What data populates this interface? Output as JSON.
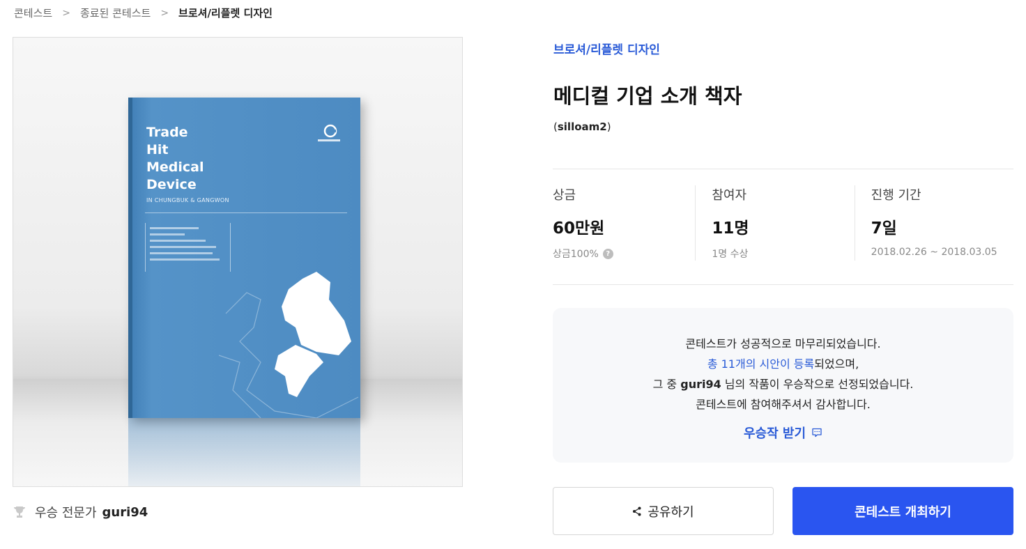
{
  "breadcrumb": {
    "items": [
      "콘테스트",
      "종료된 콘테스트",
      "브로셔/리플렛 디자인"
    ]
  },
  "image": {
    "book_title_lines": [
      "Trade",
      "Hit",
      "Medical",
      "Device"
    ],
    "book_subtitle": "IN CHUNGBUK & GANGWON"
  },
  "winner": {
    "label": "우승 전문가",
    "name": "guri94",
    "icon": "trophy-icon"
  },
  "contest": {
    "category": "브로셔/리플렛 디자인",
    "title": "메디컬 기업 소개 책자",
    "userid_open": "(",
    "userid": "silloam2",
    "userid_close": ")"
  },
  "stats": {
    "prize": {
      "label": "상금",
      "value": "60만원",
      "sub": "상금100%",
      "help_icon": "question-icon"
    },
    "participants": {
      "label": "참여자",
      "value": "11명",
      "sub": "1명 수상"
    },
    "period": {
      "label": "진행 기간",
      "value": "7일",
      "sub": "2018.02.26 ~ 2018.03.05"
    }
  },
  "notice": {
    "line1": "콘테스트가 성공적으로 마무리되었습니다.",
    "line2_link": "총 11개의 시안이 등록",
    "line2_rest": "되었으며,",
    "line3_pre": "그 중 ",
    "line3_name": "guri94",
    "line3_post": " 님의 작품이 우승작으로 선정되었습니다.",
    "line4": "콘테스트에 참여해주셔서 감사합니다.",
    "cta": "우승작 받기"
  },
  "buttons": {
    "share": "공유하기",
    "host": "콘테스트 개최하기"
  },
  "colors": {
    "accent": "#2a5bd7",
    "primary_button": "#2a55f0",
    "book_blue": "#4d8bc2"
  }
}
